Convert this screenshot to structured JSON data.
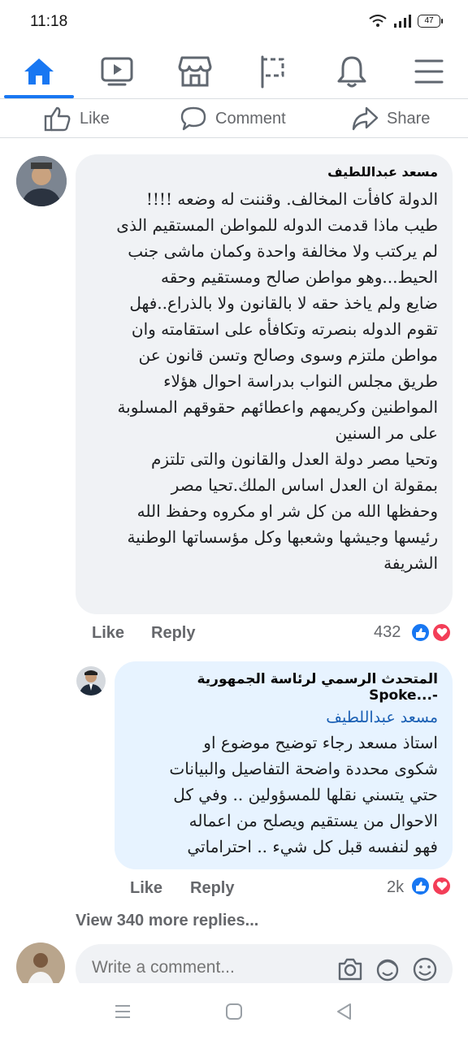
{
  "status_bar": {
    "time": "11:18",
    "battery": "47"
  },
  "nav": {
    "items": [
      "home-icon",
      "video-icon",
      "marketplace-icon",
      "pages-flag-icon",
      "notifications-bell-icon",
      "menu-icon"
    ]
  },
  "actions": {
    "like": "Like",
    "comment": "Comment",
    "share": "Share"
  },
  "comment": {
    "author": "مسعد عبداللطيف",
    "lines": [
      "الدولة كافأت المخالف. وقننت له وضعه !!!!",
      "طيب ماذا قدمت الدوله للمواطن المستقيم الذى",
      "لم يركتب ولا مخالفة واحدة وكمان ماشى جنب",
      "الحيط...وهو مواطن صالح ومستقيم وحقه",
      "ضايع ولم ياخذ حقه لا بالقانون ولا بالذراع..فهل",
      "تقوم الدوله بنصرته وتكافأه على استقامته وان",
      "مواطن ملتزم وسوى وصالح وتسن قانون عن",
      "طريق مجلس النواب بدراسة احوال هؤلاء",
      "المواطنين وكريمهم واعطائهم حقوقهم المسلوبة",
      "على مر السنين",
      "وتحيا مصر دولة العدل والقانون والتى تلتزم",
      "بمقولة ان العدل اساس الملك.تحيا مصر",
      "وحفظها الله من كل شر او مكروه وحفظ الله",
      "رئيسها وجيشها وشعبها وكل مؤسساتها الوطنية",
      "الشريفة"
    ],
    "like_label": "Like",
    "reply_label": "Reply",
    "reaction_count": "432"
  },
  "reply": {
    "author": "المتحدث الرسمي لرئاسة الجمهورية -...Spoke",
    "mention": "مسعد عبداللطيف",
    "lines": [
      "استاذ مسعد رجاء توضيح موضوع او",
      "شكوى محددة واضحة التفاصيل والبيانات",
      "حتي يتسني نقلها للمسؤولين .. وفي كل",
      "الاحوال من يستقيم ويصلح من اعماله",
      "فهو لنفسه قبل كل شيء .. احتراماتي"
    ],
    "like_label": "Like",
    "reply_label": "Reply",
    "reaction_count": "2k"
  },
  "view_more": "View 340 more replies...",
  "composer": {
    "placeholder": "Write a comment..."
  },
  "colors": {
    "accent": "#1877f2",
    "love": "#f33e58",
    "bubble": "#f0f2f5",
    "reply_bubble": "#e7f3ff"
  }
}
